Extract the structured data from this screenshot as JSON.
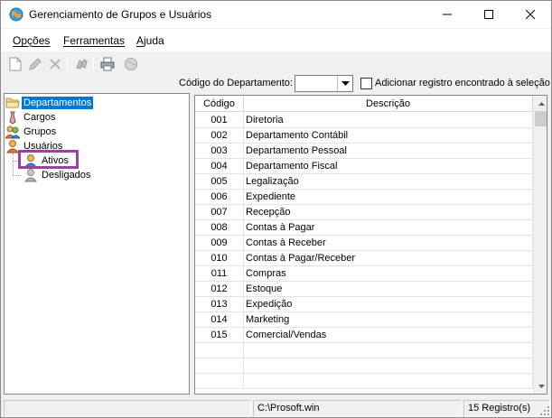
{
  "window": {
    "title": "Gerenciamento de Grupos e Usuários",
    "icon": "app-globe-icon"
  },
  "menu": {
    "items": [
      {
        "first": "O",
        "rest": "pções"
      },
      {
        "first": "F",
        "rest": "erramentas"
      },
      {
        "first": "A",
        "rest": "juda"
      }
    ]
  },
  "toolbar": {
    "icons": [
      "new-icon",
      "edit-icon",
      "delete-icon",
      "find-icon",
      "print-icon",
      "globe-icon"
    ]
  },
  "filter": {
    "code_label": "Código do Departamento:",
    "code_value": "",
    "add_label": "Adicionar registro encontrado à seleção",
    "add_checked": false
  },
  "tree": {
    "nodes": [
      {
        "label": "Departamentos",
        "icon": "folder-icon",
        "selected": true
      },
      {
        "label": "Cargos",
        "icon": "tie-icon"
      },
      {
        "label": "Grupos",
        "icon": "group-icon"
      },
      {
        "label": "Usuários",
        "icon": "user-icon"
      },
      {
        "label": "Ativos",
        "icon": "user-active-icon"
      },
      {
        "label": "Desligados",
        "icon": "user-disabled-icon"
      }
    ]
  },
  "grid": {
    "columns": [
      "Código",
      "Descrição"
    ],
    "rows": [
      [
        "001",
        "Diretoria"
      ],
      [
        "002",
        "Departamento Contábil"
      ],
      [
        "003",
        "Departamento Pessoal"
      ],
      [
        "004",
        "Departamento Fiscal"
      ],
      [
        "005",
        "Legalização"
      ],
      [
        "006",
        "Expediente"
      ],
      [
        "007",
        "Recepção"
      ],
      [
        "008",
        "Contas à Pagar"
      ],
      [
        "009",
        "Contas à Receber"
      ],
      [
        "010",
        "Contas à Pagar/Receber"
      ],
      [
        "011",
        "Compras"
      ],
      [
        "012",
        "Estoque"
      ],
      [
        "013",
        "Expedição"
      ],
      [
        "014",
        "Marketing"
      ],
      [
        "015",
        "Comercial/Vendas"
      ]
    ]
  },
  "status": {
    "panel1": "",
    "path": "C:\\Prosoft.win",
    "records": "15 Registro(s)"
  },
  "colors": {
    "selection": "#0078d7",
    "highlight_box": "#9b3fa3"
  }
}
